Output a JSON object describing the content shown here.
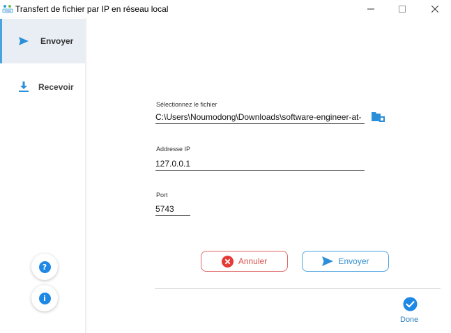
{
  "window": {
    "title": "Transfert de fichier par IP en réseau local",
    "app_icon_text": "TRNS",
    "controls": {
      "minimize": "minimize-icon",
      "maximize": "maximize-icon",
      "close": "close-icon"
    }
  },
  "sidebar": {
    "items": [
      {
        "label": "Envoyer",
        "icon": "send-icon",
        "active": true
      },
      {
        "label": "Recevoir",
        "icon": "download-icon",
        "active": false
      }
    ],
    "help_icon": "?",
    "info_icon": "i"
  },
  "form": {
    "file": {
      "label": "Sélectionnez le fichier",
      "value": "C:\\Users\\Noumodong\\Downloads\\software-engineer-at-"
    },
    "ip": {
      "label": "Addresse IP",
      "value": "127.0.0.1"
    },
    "port": {
      "label": "Port",
      "value": "5743"
    }
  },
  "actions": {
    "cancel_label": "Annuler",
    "send_label": "Envoyer",
    "done_label": "Done"
  },
  "colors": {
    "accent": "#4aa3df",
    "cancel": "#d9534f",
    "active_bg": "#e9eef5",
    "icon_blue": "#1e88e5"
  }
}
